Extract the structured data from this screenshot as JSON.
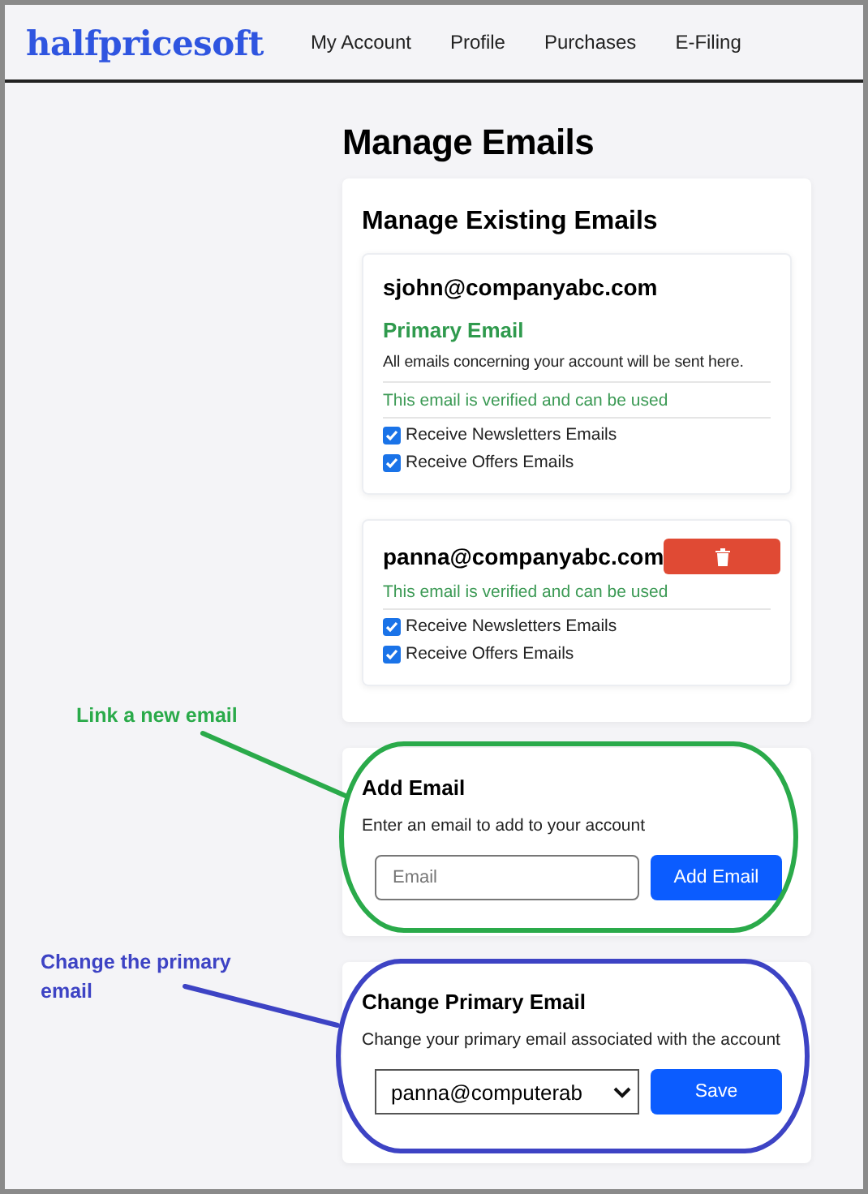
{
  "nav": {
    "logo": "halfpricesoft",
    "links": [
      "My Account",
      "Profile",
      "Purchases",
      "E-Filing"
    ]
  },
  "page_title": "Manage Emails",
  "existing": {
    "title": "Manage Existing Emails",
    "emails": [
      {
        "address": "sjohn@companyabc.com",
        "primary": true,
        "primary_label": "Primary Email",
        "primary_note": "All emails concerning your account will be sent here.",
        "verified_text": "This email is verified and can be used",
        "options": [
          {
            "label": "Receive Newsletters Emails",
            "checked": true
          },
          {
            "label": "Receive Offers Emails",
            "checked": true
          }
        ]
      },
      {
        "address": "panna@companyabc.com",
        "primary": false,
        "verified_text": "This email is verified and can be used",
        "options": [
          {
            "label": "Receive Newsletters Emails",
            "checked": true
          },
          {
            "label": "Receive Offers Emails",
            "checked": true
          }
        ]
      }
    ]
  },
  "add_email": {
    "title": "Add Email",
    "description": "Enter an email to add to your account",
    "placeholder": "Email",
    "button": "Add Email",
    "annotation": {
      "text": "Link a new email",
      "color": "#2aaa4a"
    }
  },
  "change_primary": {
    "title": "Change Primary Email",
    "description": "Change your primary email associated with the account",
    "value": "panna@computerab",
    "button": "Save",
    "annotation": {
      "text": "Change the primary email",
      "color": "#3d43c4"
    }
  }
}
